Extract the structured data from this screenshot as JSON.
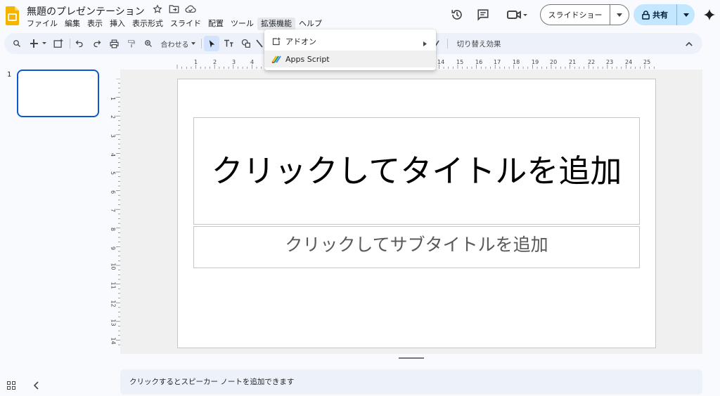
{
  "app": {
    "doc_title": "無題のプレゼンテーション"
  },
  "menu": [
    "ファイル",
    "編集",
    "表示",
    "挿入",
    "表示形式",
    "スライド",
    "配置",
    "ツール",
    "拡張機能",
    "ヘルプ"
  ],
  "header": {
    "slideshow_label": "スライドショー",
    "share_label": "共有"
  },
  "toolbar": {
    "fit_label": "合わせる",
    "transition_label": "切り替え効果"
  },
  "extensions_menu": {
    "addon_label": "アドオン",
    "apps_script_label": "Apps Script"
  },
  "filmstrip": {
    "slide_number": "1"
  },
  "ruler": {
    "horizontal": [
      "1",
      "2",
      "3",
      "4",
      "14",
      "15",
      "16",
      "17",
      "18",
      "19",
      "20",
      "21",
      "22",
      "23",
      "24",
      "25"
    ],
    "vertical": [
      "1",
      "2",
      "3",
      "4",
      "5",
      "6",
      "7",
      "8",
      "9",
      "10",
      "11",
      "12",
      "13",
      "14"
    ]
  },
  "slide": {
    "title_placeholder": "クリックしてタイトルを追加",
    "subtitle_placeholder": "クリックしてサブタイトルを追加"
  },
  "notes": {
    "placeholder": "クリックするとスピーカー ノートを追加できます"
  },
  "colors": {
    "accent": "#0b57d0",
    "share_bg": "#c2e7ff",
    "logo_yellow": "#f4b400"
  }
}
